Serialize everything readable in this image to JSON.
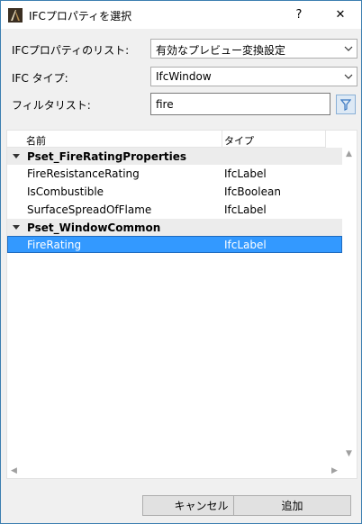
{
  "window": {
    "title": "IFCプロパティを選択",
    "help_glyph": "?",
    "close_glyph": "✕"
  },
  "form": {
    "property_list_label": "IFCプロパティのリスト:",
    "property_list_value": "有効なプレビュー変換設定",
    "ifc_type_label": "IFC タイプ:",
    "ifc_type_value": "IfcWindow",
    "filter_label": "フィルタリスト:",
    "filter_value": "fire"
  },
  "list": {
    "columns": {
      "name": "名前",
      "type": "タイプ"
    },
    "groups": [
      {
        "name": "Pset_FireRatingProperties",
        "rows": [
          {
            "name": "FireResistanceRating",
            "type": "IfcLabel"
          },
          {
            "name": "IsCombustible",
            "type": "IfcBoolean"
          },
          {
            "name": "SurfaceSpreadOfFlame",
            "type": "IfcLabel"
          }
        ]
      },
      {
        "name": "Pset_WindowCommon",
        "rows": [
          {
            "name": "FireRating",
            "type": "IfcLabel",
            "selected": true
          }
        ]
      }
    ]
  },
  "buttons": {
    "cancel": "キャンセル",
    "add": "追加"
  },
  "colors": {
    "selection": "#3399ff",
    "group_bg": "#ececec",
    "window_border": "#3c7fb1"
  }
}
